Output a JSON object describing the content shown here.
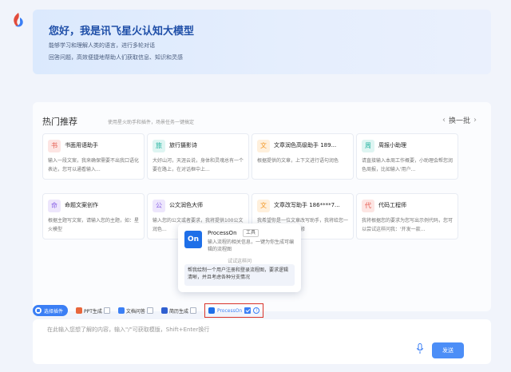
{
  "banner": {
    "title": "您好，我是讯飞星火认知大模型",
    "line1": "能够学习和理解人类的语言，进行多轮对话",
    "line2": "回答问题，高效便捷地帮助人们获取信息、知识和灵感"
  },
  "recommend": {
    "title": "热门推荐",
    "subtitle": "使用星火助手和插件，场景任务一键搞定",
    "next_label": "换一批",
    "cards": [
      {
        "badge": "书",
        "title": "书面用语助手",
        "desc": "输入一段文案，我来确保需要不出我口语化表达，您可以通看输入..."
      },
      {
        "badge": "旅",
        "title": "旅行摄影诗",
        "desc": "大好山河，天涯云说，身体和灵魂总有一个要在路上，在对话框中上..."
      },
      {
        "badge": "文",
        "title": "文章润色高级助手 189...",
        "desc": "根据提供的文章，上下文进行语句润色"
      },
      {
        "badge": "周",
        "title": "周报小助理",
        "desc": "请直接输入本周工作概要，小助理会帮您润色周报，比如输入'用户..."
      },
      {
        "badge": "命",
        "title": "命题文案创作",
        "desc": "根据主题写文案，请输入您的主题，如：星火模型"
      },
      {
        "badge": "公",
        "title": "公文润色大师",
        "desc": "输入您的公文或者要求，我将提供100公文润色..."
      },
      {
        "badge": "文",
        "title": "文章改写助手 186****7...",
        "desc": "我希望你是一位文章改写助手，我将给您一篇文本文章内容进行修"
      },
      {
        "badge": "代",
        "title": "代码工程师",
        "desc": "我将根据您的要求为您写出示例代码，您可以尝试这样问我：'开发一款..."
      }
    ]
  },
  "toolbar": {
    "select_plugin": "选择插件",
    "plugins": [
      {
        "label": "PPT生成",
        "checked": false
      },
      {
        "label": "文档问答",
        "checked": false
      },
      {
        "label": "简历生成",
        "checked": false
      },
      {
        "label": "ProcessOn",
        "checked": true
      }
    ]
  },
  "popup": {
    "logo_text": "On",
    "name": "ProcessOn",
    "tag": "工具",
    "desc": "输入流程的相关信息，一键为你生成可编辑的流程图",
    "try_label": "试试这样问",
    "example": "帮我绘制一个用户注册和登录流程图，要求逻辑清晰，并且考虑各种分支情况"
  },
  "input": {
    "placeholder": "在此输入您想了解的内容，输入\"/\"可获取模版，Shift+Enter换行",
    "send_label": "发送"
  },
  "colors": {
    "accent": "#3b7ff5",
    "highlight_border": "#d9342b"
  }
}
